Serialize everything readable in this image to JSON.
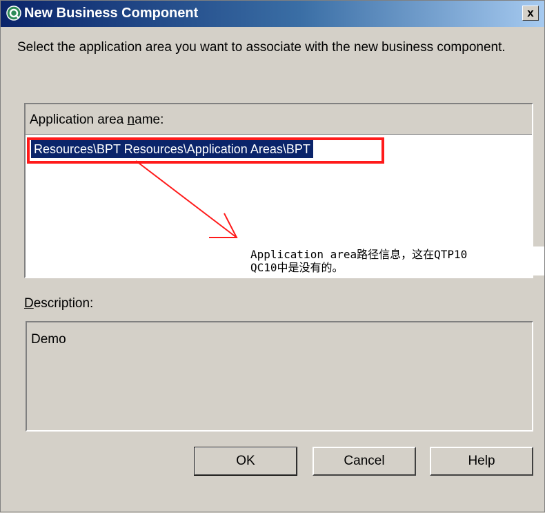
{
  "window": {
    "title": "New Business Component",
    "close_glyph": "x"
  },
  "instruction": "Select the application area you want to associate with the new business component.",
  "application_area": {
    "header_label_pre": "Application area ",
    "header_label_ul": "n",
    "header_label_post": "ame:",
    "selected_item": "Resources\\BPT Resources\\Application Areas\\BPT"
  },
  "annotation": {
    "line1": "Application area路径信息，这在QTP10",
    "line2": "QC10中是没有的。"
  },
  "description": {
    "label_ul": "D",
    "label_post": "escription:",
    "value": "Demo"
  },
  "buttons": {
    "ok": "OK",
    "cancel": "Cancel",
    "help": "Help"
  },
  "colors": {
    "annotation_red": "#ff1a1a",
    "selection_blue": "#0a246a"
  },
  "icons": {
    "app": "qtp-app-icon",
    "close": "close-icon"
  }
}
